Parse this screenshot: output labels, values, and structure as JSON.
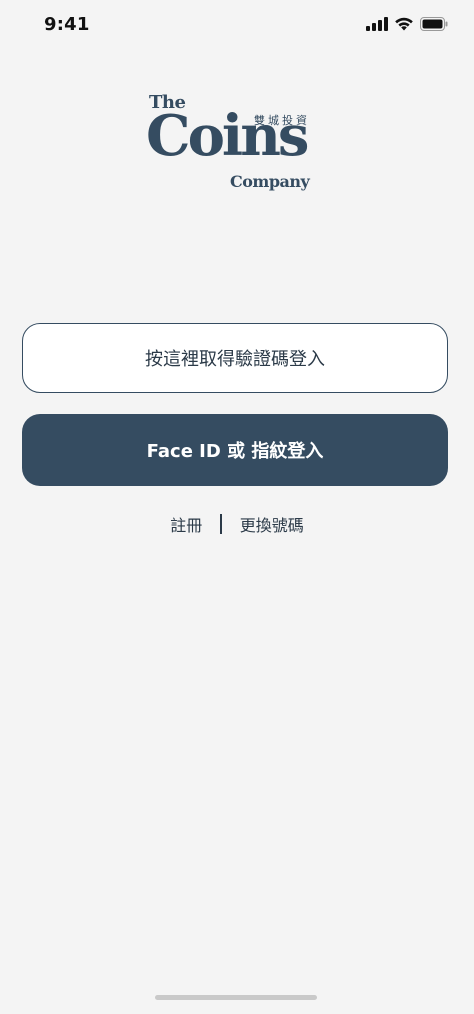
{
  "status_bar": {
    "time": "9:41"
  },
  "logo": {
    "the": "The",
    "coins": "Coins",
    "company": "Company",
    "cjk": "雙城投資"
  },
  "actions": {
    "otp_label": "按這裡取得驗證碼登入",
    "faceid_label": "Face ID 或 指紋登入"
  },
  "links": {
    "register": "註冊",
    "change_number": "更換號碼"
  },
  "colors": {
    "brand": "#354c61",
    "background": "#f4f4f4"
  }
}
